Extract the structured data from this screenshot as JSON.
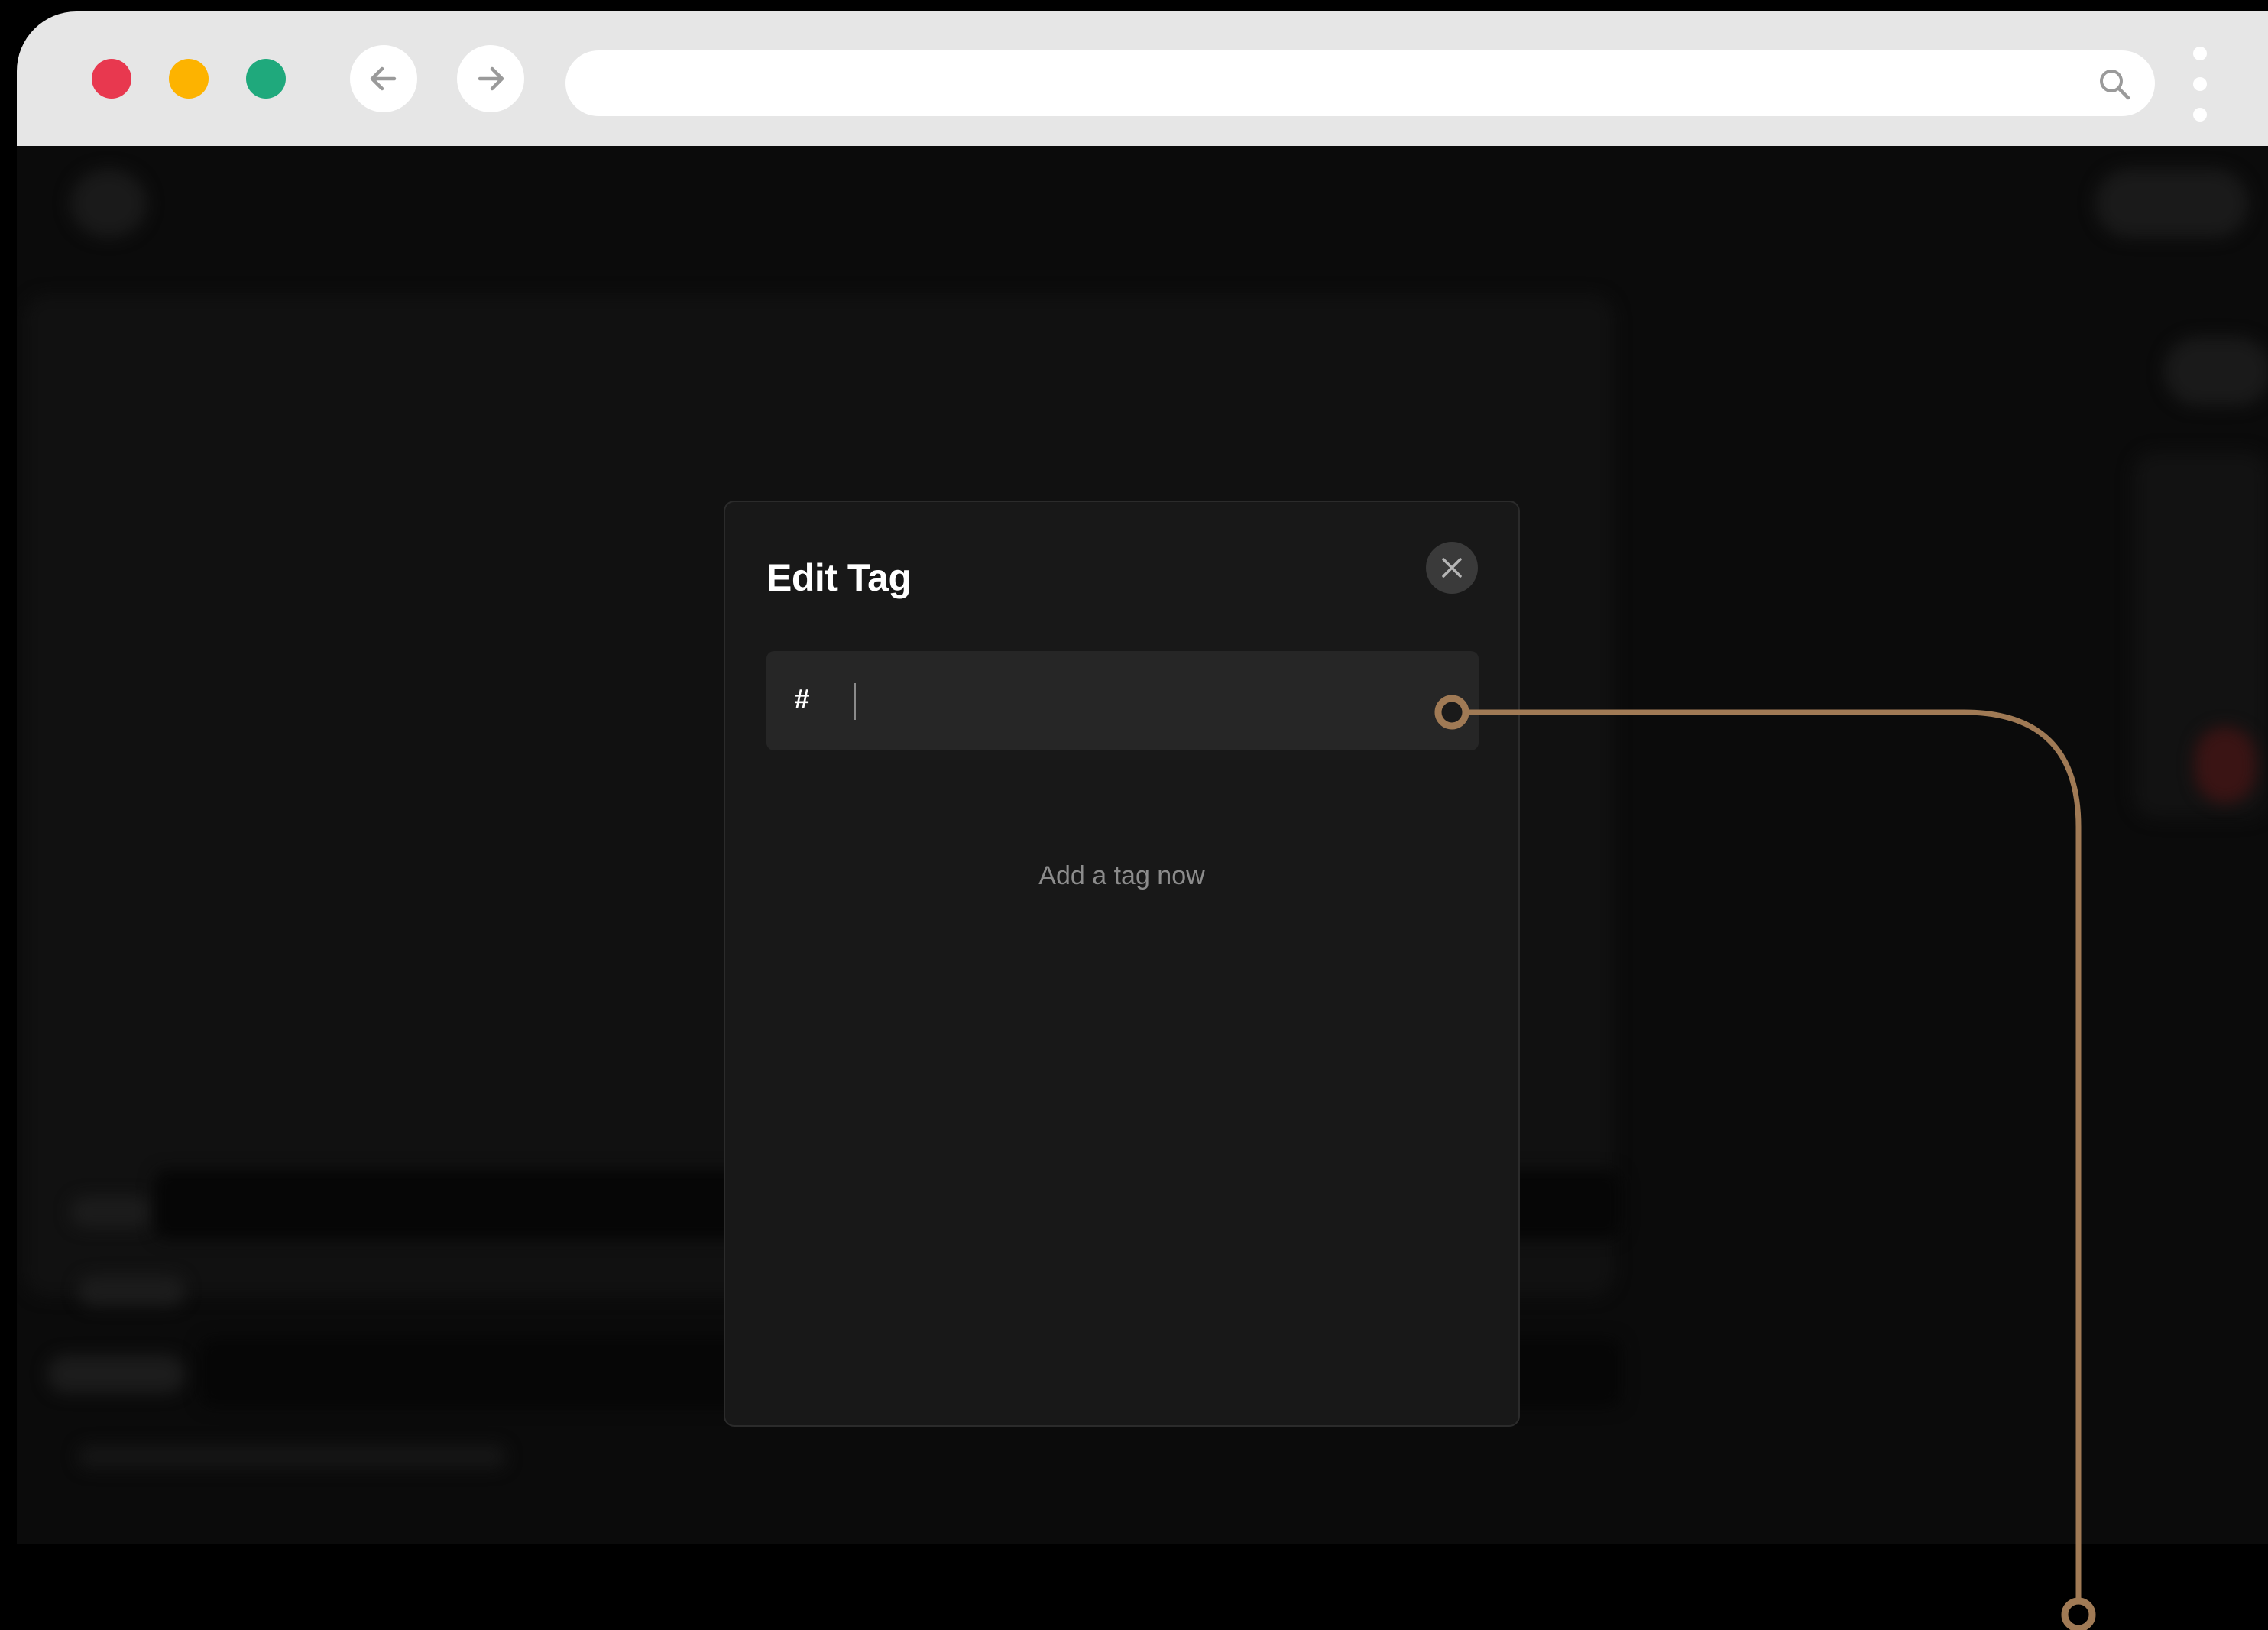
{
  "browser": {
    "url_value": "",
    "traffic_lights": {
      "close": "#e8384f",
      "minimize": "#fdb300",
      "maximize": "#1fa97c"
    },
    "icons": [
      "back-arrow-icon",
      "forward-arrow-icon",
      "search-icon",
      "more-vertical-icon"
    ]
  },
  "modal": {
    "title": "Edit Tag",
    "tag_prefix": "#",
    "tag_input_value": "",
    "empty_state": "Add a tag now",
    "close_icon": "close-icon"
  },
  "annotation": {
    "color": "#a07a55"
  }
}
